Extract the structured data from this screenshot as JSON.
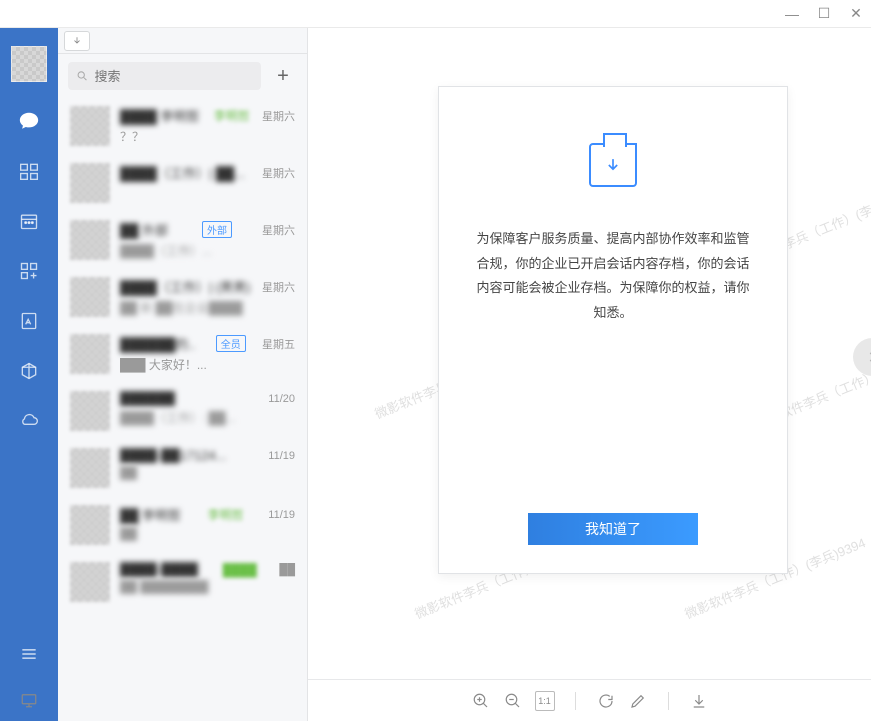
{
  "window": {
    "min": "—",
    "max": "☐",
    "close": "✕"
  },
  "search": {
    "placeholder": "搜索",
    "add": "+"
  },
  "conversations": [
    {
      "name": "████ 李明哲",
      "msg": "？？",
      "time": "星期六",
      "green": true
    },
    {
      "name": "████（工作）| ██...",
      "msg": "",
      "time": "星期六"
    },
    {
      "name": "██ 外部",
      "msg": "████（工作）...",
      "time": "星期六",
      "badge_ext": "外部"
    },
    {
      "name": "████（工作）| (男男)",
      "msg": "██ 新 ██在企业████",
      "time": "星期六"
    },
    {
      "name": "██████的..",
      "msg": "███ 大家好！...",
      "time": "星期五",
      "badge_all": "全员"
    },
    {
      "name": "██████",
      "msg": "████（工作）: ██...",
      "time": "11/20"
    },
    {
      "name": "████-██17124...",
      "msg": "██",
      "time": "11/19"
    },
    {
      "name": "██ 李明哲",
      "msg": "██",
      "time": "11/19",
      "green": true
    },
    {
      "name": "████-████",
      "msg": "██ ████████",
      "time": "██",
      "green": true
    }
  ],
  "card": {
    "text": "为保障客户服务质量、提高内部协作效率和监管合规，你的企业已开启会话内容存档，你的会话内容可能会被企业存档。为保障你的权益，请你知悉。",
    "confirm": "我知道了"
  },
  "watermark": "微影软件李兵（工作）(李兵)9394",
  "bottom": {
    "page": "1:1"
  }
}
